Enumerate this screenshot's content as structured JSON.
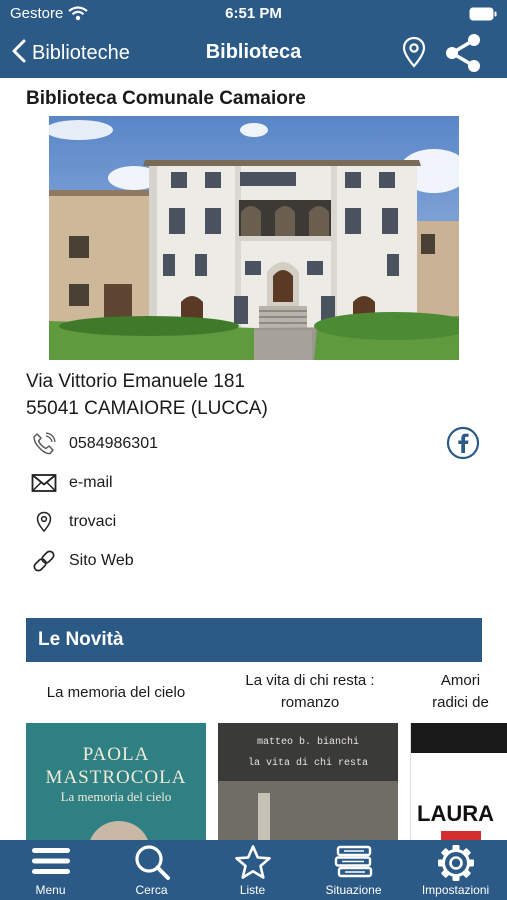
{
  "status_bar": {
    "carrier": "Gestore",
    "time": "6:51 PM"
  },
  "nav": {
    "back_label": "Biblioteche",
    "title": "Biblioteca"
  },
  "library": {
    "name": "Biblioteca Comunale Camaiore",
    "address_line1": "Via Vittorio Emanuele 181",
    "address_line2": "55041 CAMAIORE (LUCCA)"
  },
  "contacts": {
    "phone": "0584986301",
    "email": "e-mail",
    "map": "trovaci",
    "website": "Sito Web"
  },
  "novita": {
    "header": "Le Novità",
    "books": [
      {
        "title": "La memoria del cielo",
        "cover_author": "PAOLA MASTROCOLA",
        "cover_title": "La memoria del cielo"
      },
      {
        "title": "La vita di chi resta : romanzo",
        "cover_author": "matteo b. bianchi",
        "cover_title": "la vita di chi resta"
      },
      {
        "title": "Amori radici de",
        "cover_author": "LAURA"
      }
    ]
  },
  "tabs": [
    {
      "label": "Menu",
      "icon": "menu-icon"
    },
    {
      "label": "Cerca",
      "icon": "search-icon"
    },
    {
      "label": "Liste",
      "icon": "star-icon"
    },
    {
      "label": "Situazione",
      "icon": "books-icon"
    },
    {
      "label": "Impostazioni",
      "icon": "gear-icon"
    }
  ],
  "colors": {
    "brand": "#2b5a87",
    "facebook": "#2b5a87"
  }
}
